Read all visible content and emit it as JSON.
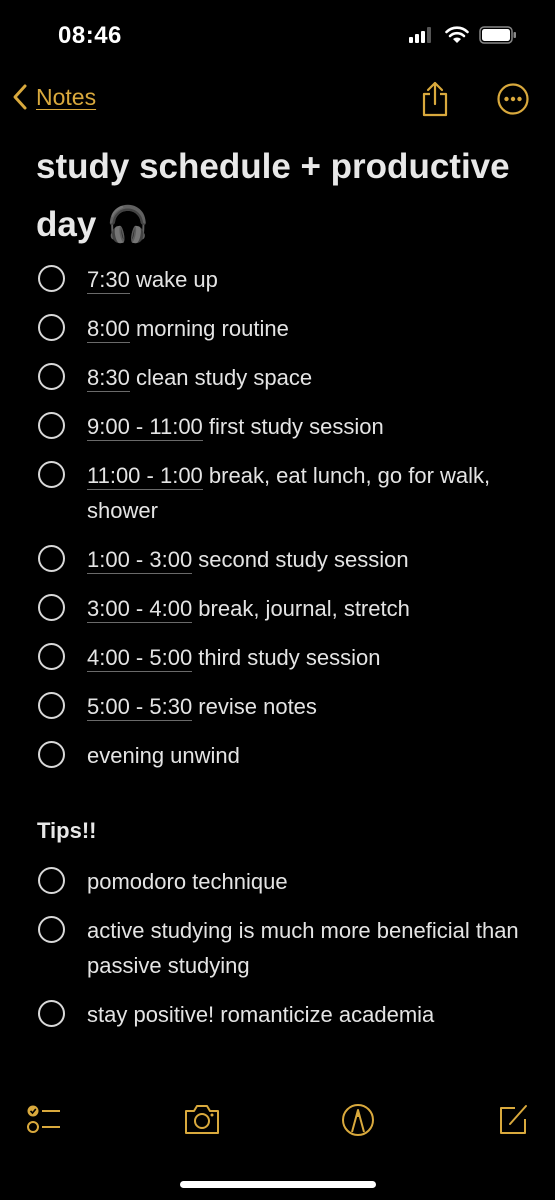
{
  "status_bar": {
    "time": "08:46"
  },
  "nav": {
    "back_label": "Notes"
  },
  "accent_color": "#d9a93d",
  "note": {
    "title": "study schedule + productive day 🎧",
    "schedule": [
      {
        "time": "7:30",
        "text": " wake up"
      },
      {
        "time": "8:00",
        "text": " morning routine"
      },
      {
        "time": "8:30",
        "text": " clean study space"
      },
      {
        "time": "9:00 - 11:00",
        "text": " first study session"
      },
      {
        "time": "11:00 - 1:00",
        "text": " break, eat lunch, go for walk, shower"
      },
      {
        "time": "1:00 - 3:00",
        "text": " second study session"
      },
      {
        "time": "3:00 - 4:00",
        "text": " break, journal, stretch"
      },
      {
        "time": "4:00 - 5:00",
        "text": " third study session"
      },
      {
        "time": "5:00 - 5:30",
        "text": " revise notes"
      },
      {
        "time": "",
        "text": "evening unwind"
      }
    ],
    "tips_heading": "Tips!!",
    "tips": [
      {
        "text": "pomodoro technique"
      },
      {
        "text": "active studying is much more beneficial than passive studying"
      },
      {
        "text": "stay positive! romanticize academia"
      }
    ]
  },
  "toolbar": {
    "icons": [
      "checklist-icon",
      "camera-icon",
      "markup-pen-icon",
      "compose-icon"
    ]
  }
}
